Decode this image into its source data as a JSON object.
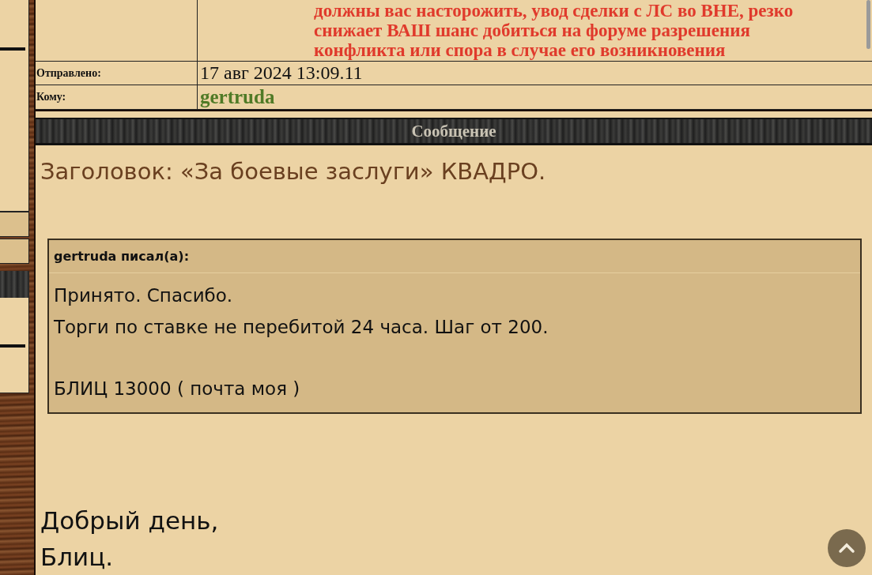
{
  "header_table": {
    "warning_lines": [
      "должны вас насторожить, увод сделки с ЛС во ВНЕ, резко",
      "снижает ВАШ шанс добиться на форуме разрешения",
      "конфликта или спора в случае его возникновения"
    ],
    "rows": [
      {
        "label": "Отправлено:",
        "value": "17 авг 2024 13:09.11",
        "kind": "date"
      },
      {
        "label": "Кому:",
        "value": "gertruda",
        "kind": "user"
      }
    ]
  },
  "message_banner": "Сообщение",
  "subject": "Заголовок: «За боевые заслуги» КВАДРО.",
  "quote": {
    "author": "gertruda писал(а):",
    "paragraphs": [
      [
        "Принято. Спасибо.",
        "Торги по ставке не перебитой 24 часа. Шаг от 200."
      ],
      [
        "БЛИЦ 13000 ( почта моя )"
      ]
    ]
  },
  "body_lines": [
    "Добрый день,",
    "Блиц."
  ]
}
